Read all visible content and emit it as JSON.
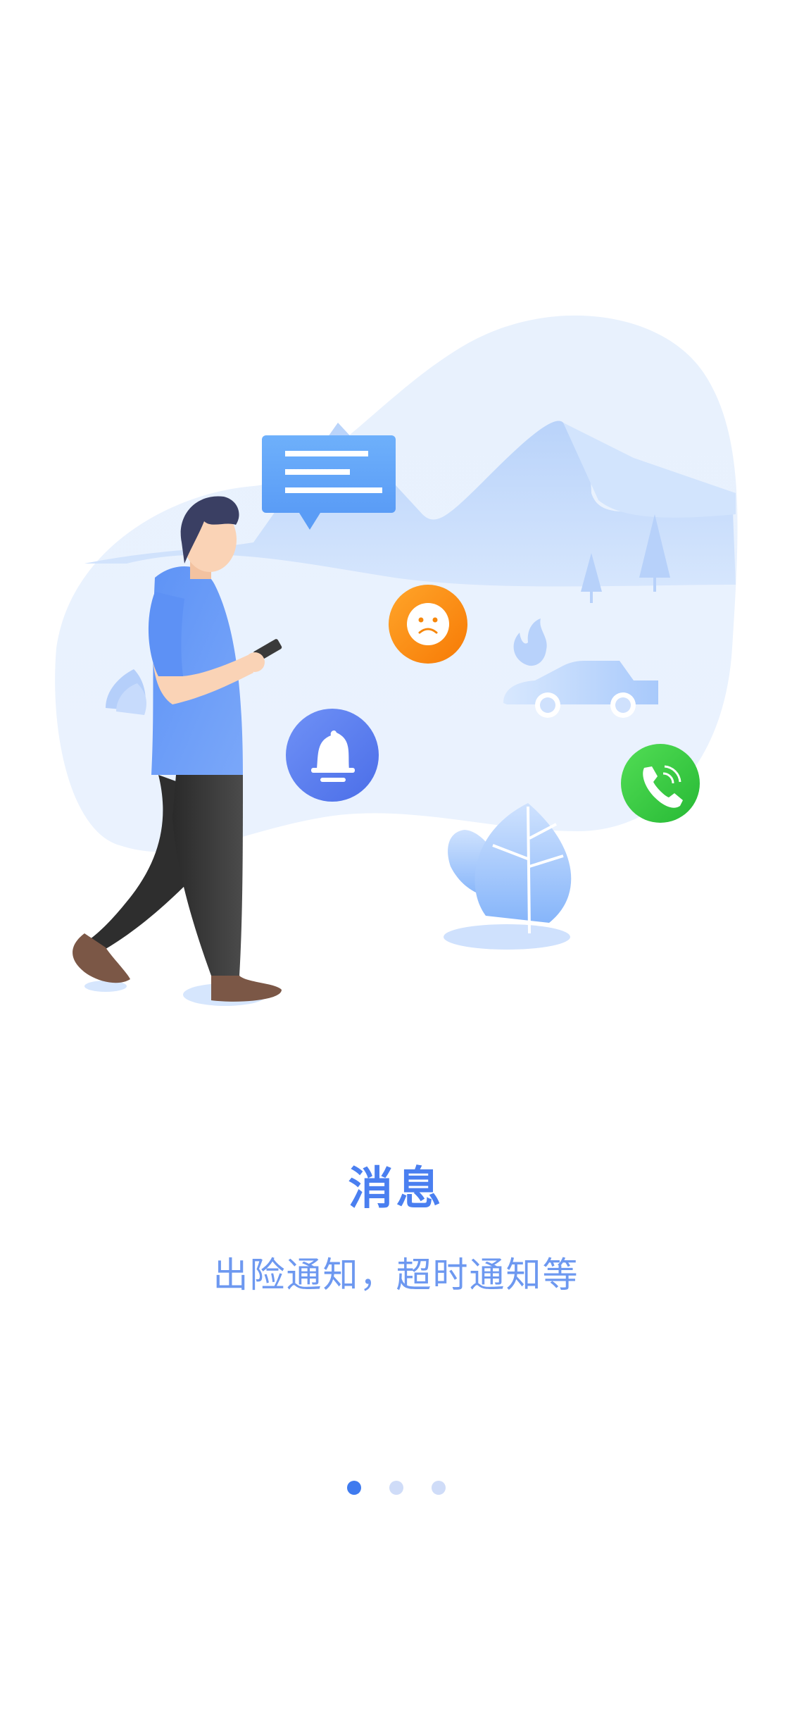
{
  "onboarding": {
    "title": "消息",
    "subtitle": "出险通知，超时通知等",
    "pagination": {
      "total": 3,
      "active_index": 0
    }
  },
  "colors": {
    "accent": "#3f7bef",
    "title": "#4a7ff0",
    "subtitle": "#6d98f0",
    "dot_inactive": "#cfdcf8",
    "illustration_bg": "#e7f0fd",
    "bell_badge": "#5a7ff0",
    "sad_badge": "#fb8a0c",
    "phone_badge": "#33c93c"
  },
  "icons": [
    "message-bubble-icon",
    "sad-face-icon",
    "bell-icon",
    "phone-icon",
    "car-icon",
    "fire-icon",
    "tree-icon",
    "leaf-plant-icon"
  ]
}
